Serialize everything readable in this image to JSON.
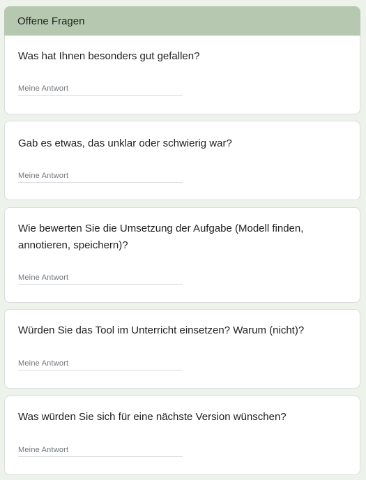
{
  "section": {
    "title": "Offene Fragen"
  },
  "questions": [
    {
      "text": "Was hat Ihnen besonders gut gefallen?",
      "placeholder": "Meine Antwort"
    },
    {
      "text": "Gab es etwas, das unklar oder schwierig war?",
      "placeholder": "Meine Antwort"
    },
    {
      "text": "Wie bewerten Sie die Umsetzung der Aufgabe (Modell finden, annotieren, speichern)?",
      "placeholder": "Meine Antwort"
    },
    {
      "text": "Würden Sie das Tool im Unterricht einsetzen? Warum (nicht)?",
      "placeholder": "Meine Antwort"
    },
    {
      "text": "Was würden Sie sich für eine nächste Version wünschen?",
      "placeholder": "Meine Antwort"
    }
  ]
}
